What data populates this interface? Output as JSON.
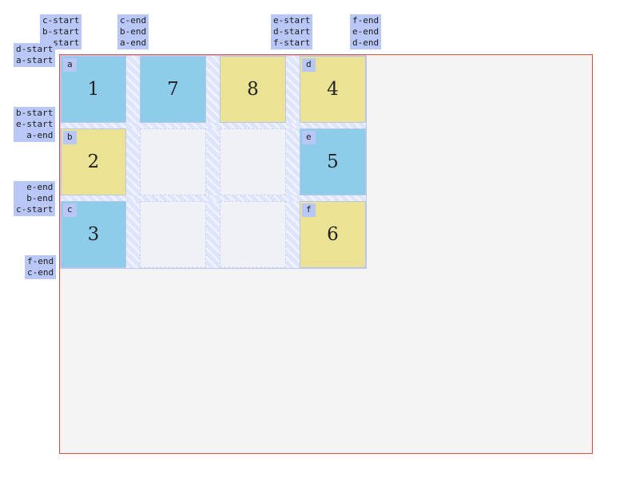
{
  "colors": {
    "blue_item": "#8ecdea",
    "yellow_item": "#ece294",
    "container_border": "#e34b3a",
    "container_bg": "#f4f4f4",
    "label_bg": "#b8c7f5"
  },
  "items": [
    {
      "number": "1",
      "area": "a",
      "color": "blue"
    },
    {
      "number": "7",
      "area": "",
      "color": "blue"
    },
    {
      "number": "8",
      "area": "",
      "color": "yellow"
    },
    {
      "number": "4",
      "area": "d",
      "color": "yellow"
    },
    {
      "number": "2",
      "area": "b",
      "color": "yellow"
    },
    {
      "number": "5",
      "area": "e",
      "color": "blue"
    },
    {
      "number": "3",
      "area": "c",
      "color": "blue"
    },
    {
      "number": "6",
      "area": "f",
      "color": "yellow"
    }
  ],
  "column_lines": [
    [
      "c-start",
      "b-start",
      "start"
    ],
    [
      "c-end",
      "b-end",
      "a-end"
    ],
    [
      "e-start",
      "d-start",
      "f-start"
    ],
    [
      "f-end",
      "e-end",
      "d-end"
    ]
  ],
  "row_lines": [
    [
      "d-start",
      "a-start"
    ],
    [
      "b-start",
      "e-start",
      "a-end"
    ],
    [
      "e-end",
      "b-end",
      "c-start"
    ],
    [
      "f-end",
      "c-end"
    ]
  ]
}
